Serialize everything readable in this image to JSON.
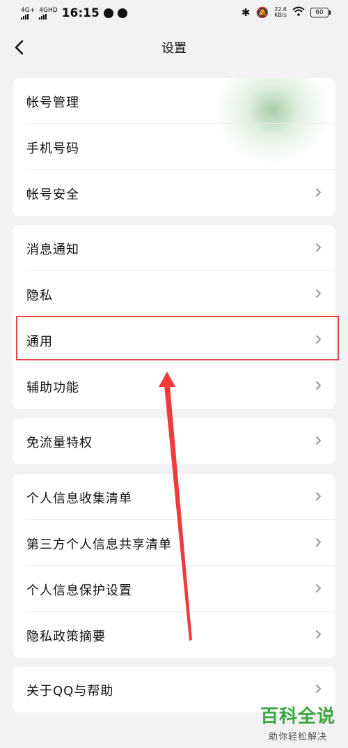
{
  "status_bar": {
    "signal1": "4G+",
    "signal2": "4GHD",
    "time": "16:15",
    "speed_value": "22.6",
    "speed_unit": "KB/s",
    "battery": "60"
  },
  "header": {
    "title": "设置"
  },
  "sections": [
    {
      "items": [
        {
          "label": "帐号管理"
        },
        {
          "label": "手机号码"
        },
        {
          "label": "帐号安全"
        }
      ]
    },
    {
      "items": [
        {
          "label": "消息通知"
        },
        {
          "label": "隐私"
        },
        {
          "label": "通用"
        },
        {
          "label": "辅助功能"
        }
      ]
    },
    {
      "items": [
        {
          "label": "免流量特权"
        }
      ]
    },
    {
      "items": [
        {
          "label": "个人信息收集清单"
        },
        {
          "label": "第三方个人信息共享清单"
        },
        {
          "label": "个人信息保护设置"
        },
        {
          "label": "隐私政策摘要"
        }
      ]
    },
    {
      "items": [
        {
          "label": "关于QQ与帮助"
        }
      ]
    }
  ],
  "annotation": {
    "highlight_color": "#e34444"
  },
  "watermark": {
    "title": "百科全说",
    "subtitle": "助你轻松解决"
  }
}
